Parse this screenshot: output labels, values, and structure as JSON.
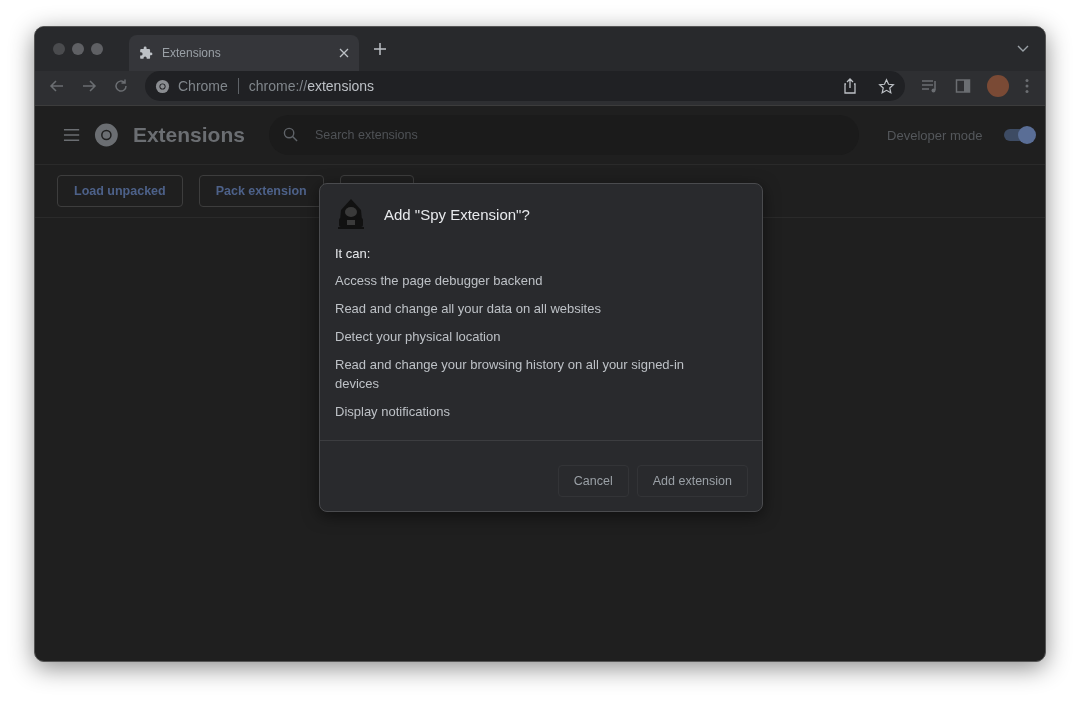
{
  "tab": {
    "title": "Extensions",
    "selected": true
  },
  "address_bar": {
    "site_label": "Chrome",
    "url_scheme": "chrome://",
    "url_path": "extensions"
  },
  "header": {
    "title": "Extensions",
    "search": {
      "placeholder": "Search extensions"
    },
    "developer_mode": {
      "label": "Developer mode",
      "on": true
    }
  },
  "toolbar_buttons": [
    {
      "label": "Load unpacked"
    },
    {
      "label": "Pack extension"
    }
  ],
  "dialog": {
    "title": "Add \"Spy Extension\"?",
    "intro": "It can:",
    "permissions": [
      "Access the page debugger backend",
      "Read and change all your data on all websites",
      "Detect your physical location",
      "Read and change your browsing history on all your signed-in devices",
      "Display notifications"
    ],
    "buttons": [
      {
        "label": "Cancel"
      },
      {
        "label": "Add extension"
      }
    ]
  }
}
